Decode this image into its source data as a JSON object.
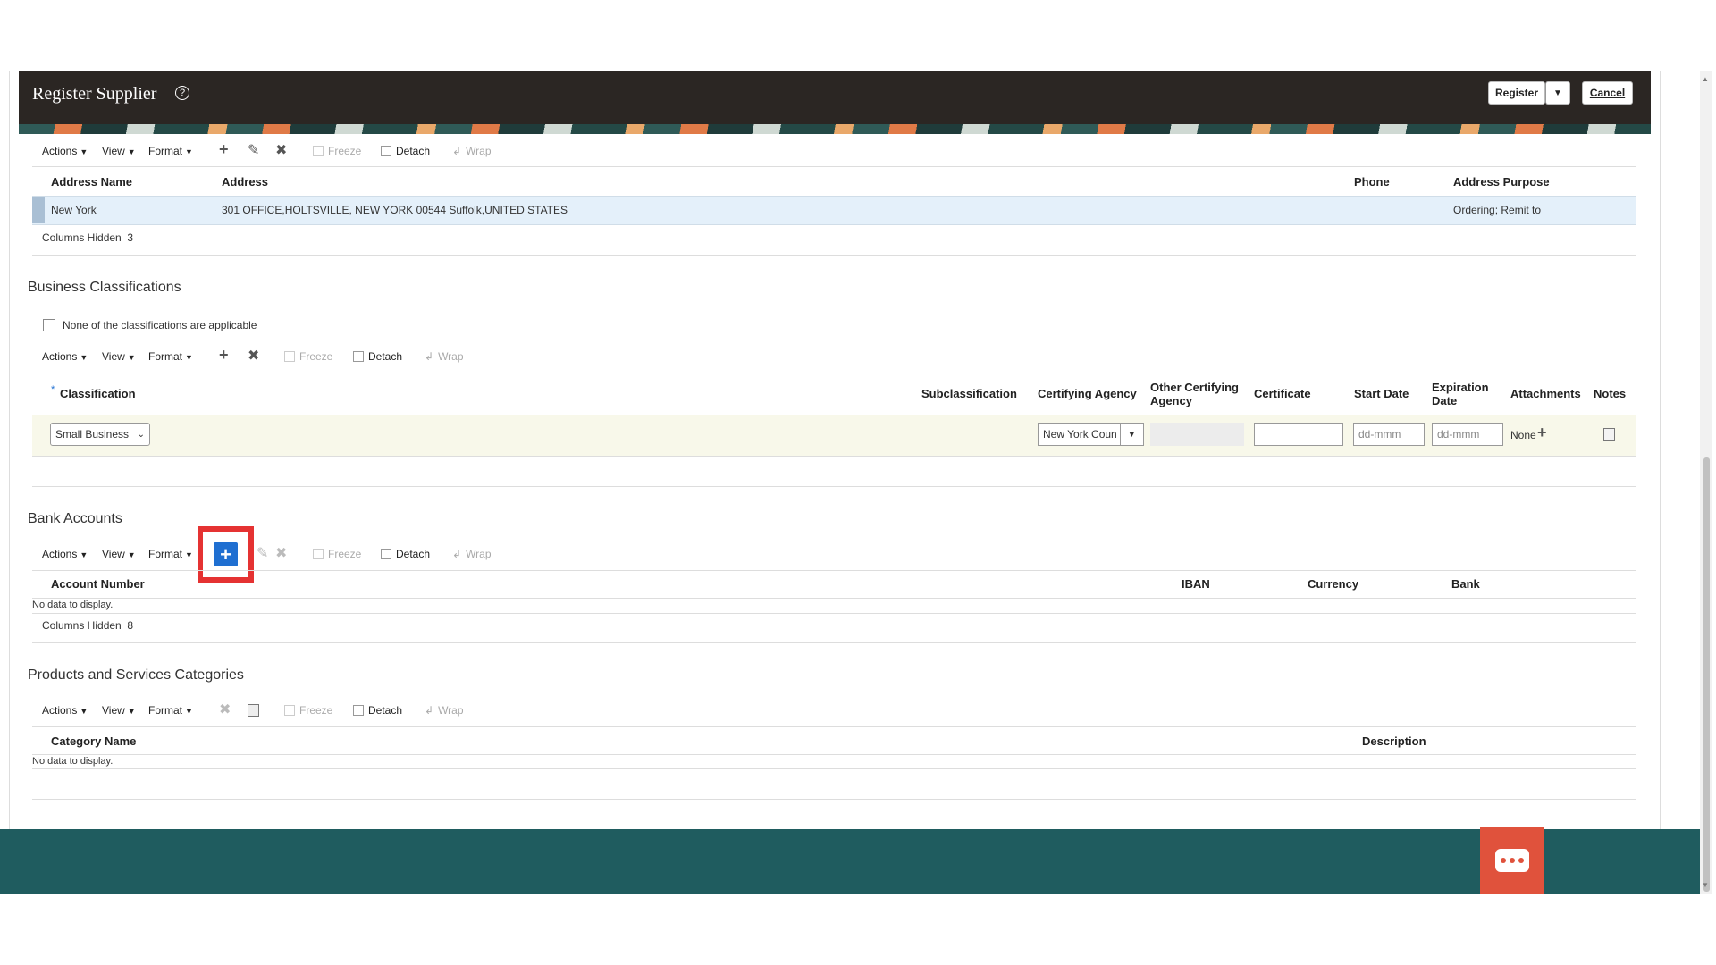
{
  "header": {
    "title": "Register Supplier",
    "help_icon": "?",
    "register_label": "Register",
    "register_dropdown": "▼",
    "cancel_label": "Cancel"
  },
  "toolbar": {
    "actions": "Actions",
    "view": "View",
    "format": "Format",
    "freeze": "Freeze",
    "detach": "Detach",
    "wrap": "Wrap"
  },
  "addresses": {
    "columns": [
      "Address Name",
      "Address",
      "Phone",
      "Address Purpose"
    ],
    "rows": [
      {
        "name": "New York",
        "address": "301 OFFICE,HOLTSVILLE, NEW YORK 00544 Suffolk,UNITED STATES",
        "phone": "",
        "purpose": "Ordering; Remit to"
      }
    ],
    "columns_hidden_label": "Columns Hidden",
    "columns_hidden_count": "3"
  },
  "business_classifications": {
    "title": "Business Classifications",
    "none_applicable_label": "None of the classifications are applicable",
    "required_marker": "*",
    "columns": [
      "Classification",
      "Subclassification",
      "Certifying Agency",
      "Other Certifying Agency",
      "Certificate",
      "Start Date",
      "Expiration Date",
      "Attachments",
      "Notes"
    ],
    "row": {
      "classification": "Small Business",
      "certifying_agency": "New York Coun",
      "start_date_placeholder": "dd-mmm",
      "expiration_date_placeholder": "dd-mmm",
      "attachments": "None"
    }
  },
  "bank_accounts": {
    "title": "Bank Accounts",
    "columns": [
      "Account Number",
      "IBAN",
      "Currency",
      "Bank"
    ],
    "no_data": "No data to display.",
    "columns_hidden_label": "Columns Hidden",
    "columns_hidden_count": "8"
  },
  "products_services": {
    "title": "Products and Services Categories",
    "columns": [
      "Category Name",
      "Description"
    ],
    "no_data": "No data to display."
  },
  "icons": {
    "add": "add-icon",
    "edit": "pencil-icon",
    "delete": "delete-icon",
    "chat": "chat-icon"
  },
  "colors": {
    "header_bg": "#2b2623",
    "footer_bg": "#1f5c5f",
    "selected_row": "#e4f0fa",
    "new_row": "#f8f8ea",
    "add_button": "#1f6fd1",
    "highlight": "#e53232",
    "chat_button": "#e0523c"
  }
}
